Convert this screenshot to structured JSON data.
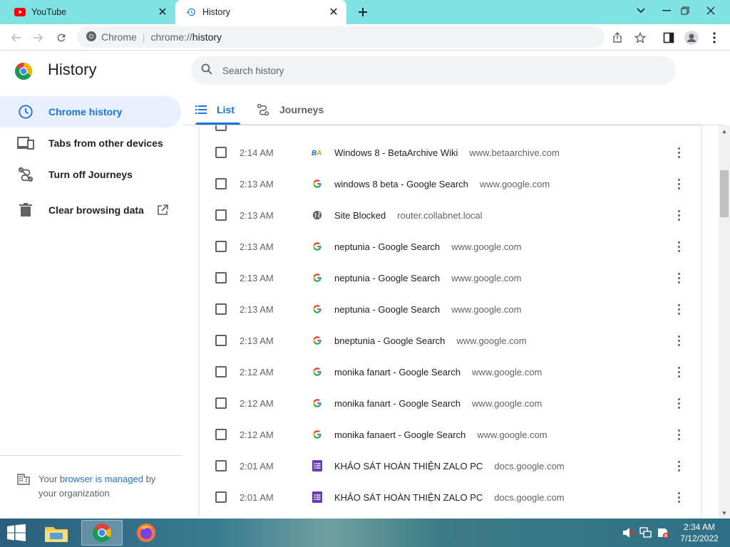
{
  "browser": {
    "tabs": [
      {
        "title": "YouTube",
        "icon": "youtube-icon",
        "active": false
      },
      {
        "title": "History",
        "icon": "history-icon",
        "active": true
      }
    ],
    "omnibox": {
      "site_label": "Chrome",
      "url_scheme": "chrome://",
      "url_host": "history"
    }
  },
  "page": {
    "title": "History",
    "search_placeholder": "Search history"
  },
  "sidebar": {
    "items": [
      {
        "label": "Chrome history",
        "icon": "clock-icon",
        "selected": true
      },
      {
        "label": "Tabs from other devices",
        "icon": "devices-icon",
        "selected": false
      },
      {
        "label": "Turn off Journeys",
        "icon": "journeys-off-icon",
        "selected": false
      },
      {
        "label": "Clear browsing data",
        "icon": "trash-icon",
        "selected": false,
        "external": true
      }
    ],
    "managed": {
      "prefix": "Your ",
      "link": "browser is managed",
      "suffix": " by your organization"
    }
  },
  "content_tabs": [
    {
      "label": "List",
      "icon": "list-icon",
      "active": true
    },
    {
      "label": "Journeys",
      "icon": "journeys-icon",
      "active": false
    }
  ],
  "history": [
    {
      "time": "2:14 AM",
      "title": "Windows 8 - BetaArchive Wiki",
      "domain": "www.betaarchive.com",
      "favicon": "betaarchive-icon"
    },
    {
      "time": "2:13 AM",
      "title": "windows 8 beta - Google Search",
      "domain": "www.google.com",
      "favicon": "google-icon"
    },
    {
      "time": "2:13 AM",
      "title": "Site Blocked",
      "domain": "router.collabnet.local",
      "favicon": "globe-icon"
    },
    {
      "time": "2:13 AM",
      "title": "neptunia - Google Search",
      "domain": "www.google.com",
      "favicon": "google-icon"
    },
    {
      "time": "2:13 AM",
      "title": "neptunia - Google Search",
      "domain": "www.google.com",
      "favicon": "google-icon"
    },
    {
      "time": "2:13 AM",
      "title": "neptunia - Google Search",
      "domain": "www.google.com",
      "favicon": "google-icon"
    },
    {
      "time": "2:13 AM",
      "title": "bneptunia - Google Search",
      "domain": "www.google.com",
      "favicon": "google-icon"
    },
    {
      "time": "2:12 AM",
      "title": "monika fanart - Google Search",
      "domain": "www.google.com",
      "favicon": "google-icon"
    },
    {
      "time": "2:12 AM",
      "title": "monika fanart - Google Search",
      "domain": "www.google.com",
      "favicon": "google-icon"
    },
    {
      "time": "2:12 AM",
      "title": "monika fanaert - Google Search",
      "domain": "www.google.com",
      "favicon": "google-icon"
    },
    {
      "time": "2:01 AM",
      "title": "KHẢO SÁT HOÀN THIỆN ZALO PC",
      "domain": "docs.google.com",
      "favicon": "google-forms-icon"
    },
    {
      "time": "2:01 AM",
      "title": "KHẢO SÁT HOÀN THIỆN ZALO PC",
      "domain": "docs.google.com",
      "favicon": "google-forms-icon"
    }
  ],
  "taskbar": {
    "clock_time": "2:34 AM",
    "clock_date": "7/12/2022",
    "apps": [
      "file-explorer-icon",
      "chrome-icon",
      "firefox-icon"
    ]
  },
  "colors": {
    "accent": "#1a73e8",
    "tabstrip": "#7fe3e3",
    "selected_bg": "#e8f0fe"
  }
}
